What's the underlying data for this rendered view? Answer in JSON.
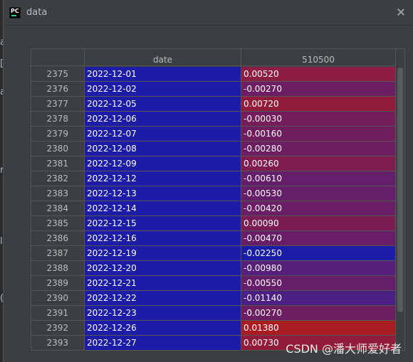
{
  "window": {
    "title": "data",
    "app_icon_text": "PC"
  },
  "left_strip_marks": [
    "a",
    "[",
    "a",
    "r",
    "l",
    "("
  ],
  "table": {
    "headers": [
      "",
      "date",
      "510500"
    ],
    "rows": [
      {
        "index": "2375",
        "date": "2022-12-01",
        "value": "0.00520",
        "color": "#8e1d46"
      },
      {
        "index": "2376",
        "date": "2022-12-02",
        "value": "-0.00270",
        "color": "#6d1e62"
      },
      {
        "index": "2377",
        "date": "2022-12-05",
        "value": "0.00720",
        "color": "#931b3a"
      },
      {
        "index": "2378",
        "date": "2022-12-06",
        "value": "-0.00030",
        "color": "#741d5a"
      },
      {
        "index": "2379",
        "date": "2022-12-07",
        "value": "-0.00160",
        "color": "#701d5e"
      },
      {
        "index": "2380",
        "date": "2022-12-08",
        "value": "-0.00280",
        "color": "#6d1e62"
      },
      {
        "index": "2381",
        "date": "2022-12-09",
        "value": "0.00260",
        "color": "#811d4e"
      },
      {
        "index": "2382",
        "date": "2022-12-12",
        "value": "-0.00610",
        "color": "#651e6a"
      },
      {
        "index": "2383",
        "date": "2022-12-13",
        "value": "-0.00530",
        "color": "#671e68"
      },
      {
        "index": "2384",
        "date": "2022-12-14",
        "value": "-0.00420",
        "color": "#6a1e65"
      },
      {
        "index": "2385",
        "date": "2022-12-15",
        "value": "0.00090",
        "color": "#7a1d55"
      },
      {
        "index": "2386",
        "date": "2022-12-16",
        "value": "-0.00470",
        "color": "#681e66"
      },
      {
        "index": "2387",
        "date": "2022-12-19",
        "value": "-0.02250",
        "color": "#1c1ca6"
      },
      {
        "index": "2388",
        "date": "2022-12-20",
        "value": "-0.00980",
        "color": "#561f7a"
      },
      {
        "index": "2389",
        "date": "2022-12-21",
        "value": "-0.00550",
        "color": "#661e69"
      },
      {
        "index": "2390",
        "date": "2022-12-22",
        "value": "-0.01140",
        "color": "#4c1f82"
      },
      {
        "index": "2391",
        "date": "2022-12-23",
        "value": "-0.00270",
        "color": "#6d1e62"
      },
      {
        "index": "2392",
        "date": "2022-12-26",
        "value": "0.01380",
        "color": "#a81c22"
      },
      {
        "index": "2393",
        "date": "2022-12-27",
        "value": "0.00730",
        "color": "#931b3a"
      }
    ]
  },
  "watermark": "CSDN @潘大师爱好者"
}
